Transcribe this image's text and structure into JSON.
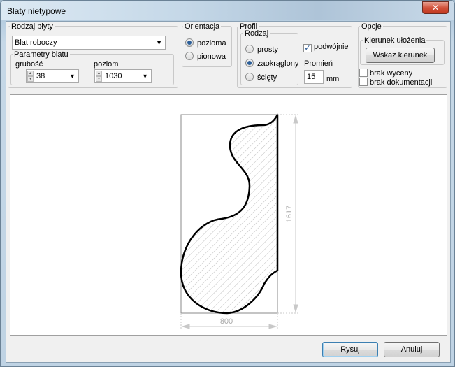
{
  "window": {
    "title": "Blaty nietypowe",
    "close_glyph": "✕"
  },
  "rodzaj_plyty": {
    "label": "Rodzaj płyty",
    "value": "Blat roboczy"
  },
  "parametry": {
    "label": "Parametry blatu",
    "grubosc_label": "grubość",
    "grubosc_value": "38",
    "poziom_label": "poziom",
    "poziom_value": "1030"
  },
  "orientacja": {
    "label": "Orientacja",
    "options": [
      "pozioma",
      "pionowa"
    ],
    "selected": "pozioma"
  },
  "profil": {
    "label": "Profil",
    "rodzaj_label": "Rodzaj",
    "options": [
      "prosty",
      "zaokrąglony",
      "ścięty"
    ],
    "selected": "zaokrąglony",
    "podwojnie_label": "podwójnie",
    "podwojnie_checked": true,
    "promien_label": "Promień",
    "promien_value": "15",
    "promien_unit": "mm"
  },
  "opcje": {
    "label": "Opcje",
    "kierunek_label": "Kierunek ułożenia",
    "wskaz_button": "Wskaż kierunek",
    "brak_wyceny": "brak wyceny",
    "brak_dokumentacji": "brak dokumentacji"
  },
  "drawing": {
    "width_dim": "800",
    "height_dim": "1617"
  },
  "buttons": {
    "rysuj": "Rysuj",
    "anuluj": "Anuluj"
  }
}
